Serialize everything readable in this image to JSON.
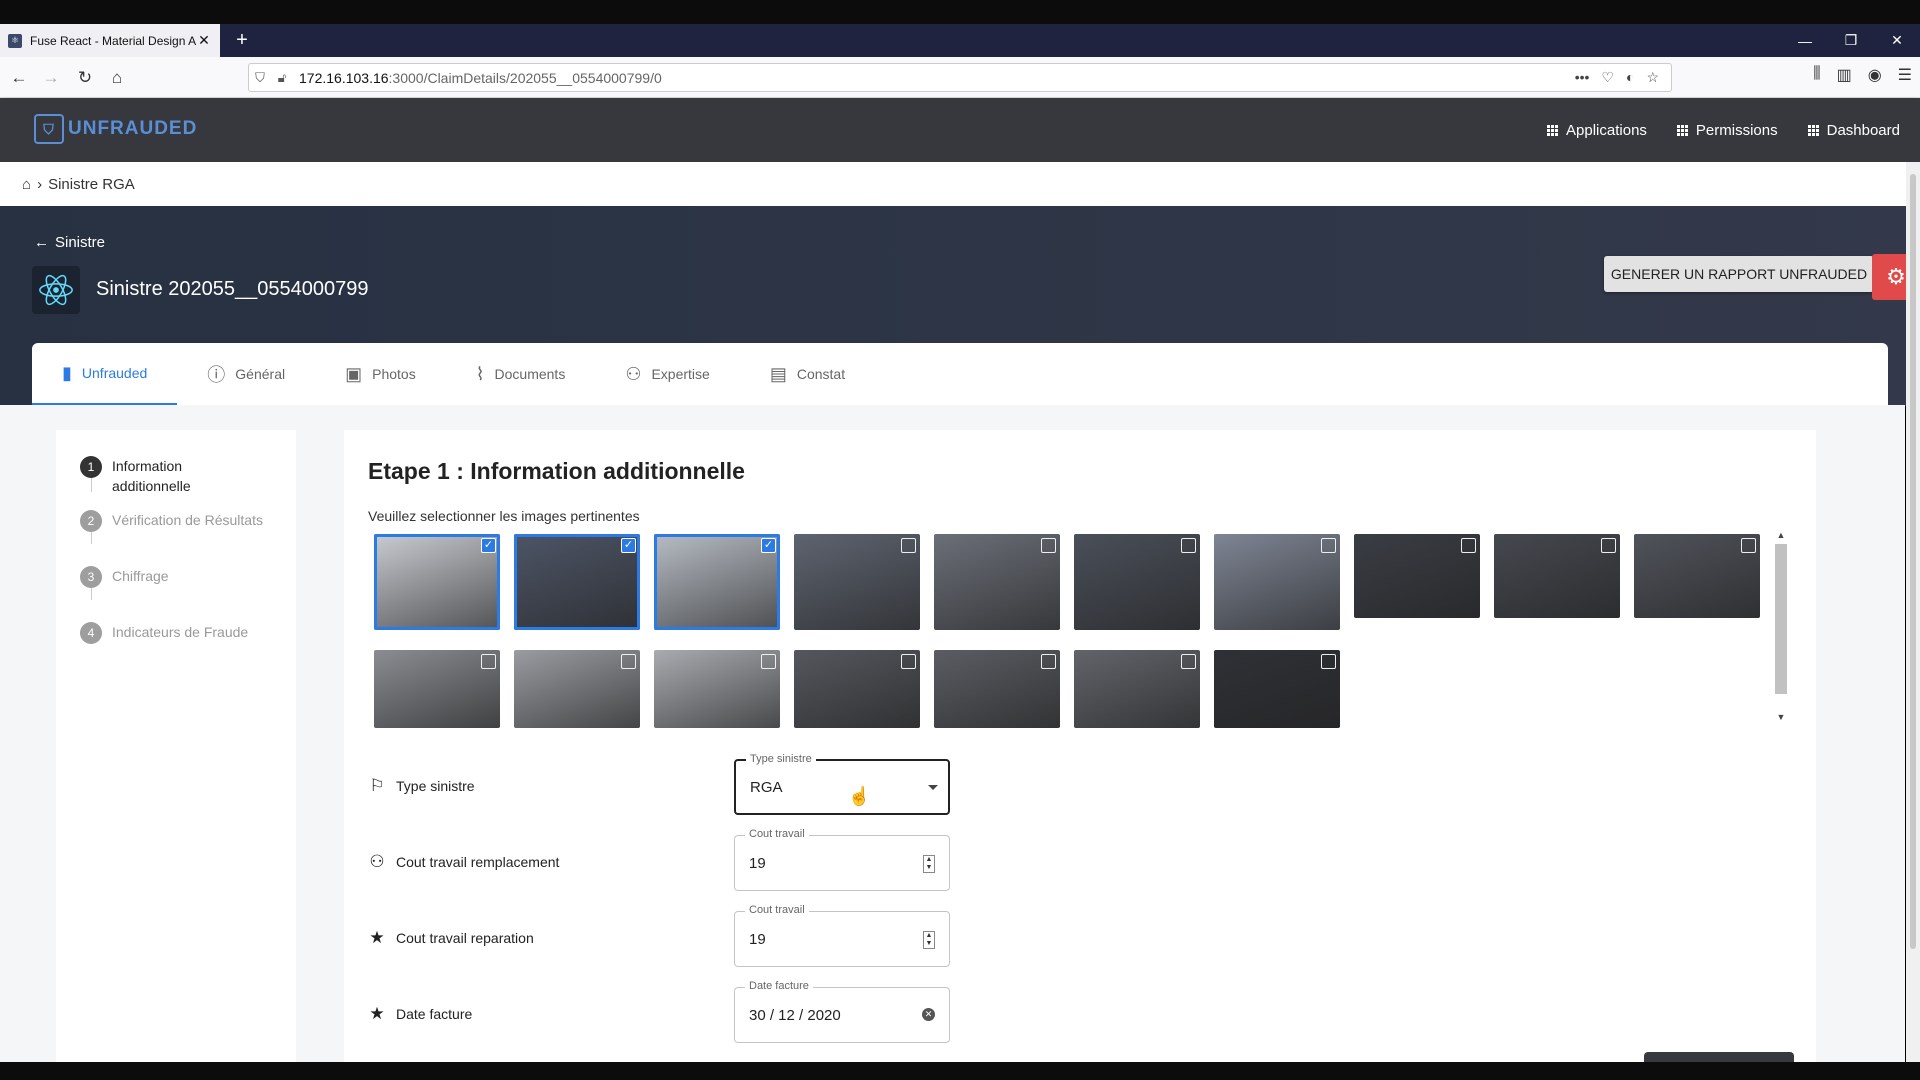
{
  "browser": {
    "tab_title": "Fuse React - Material Design A",
    "url_host": "172.16.103.16",
    "url_path": ":3000/ClaimDetails/202055__0554000799/0"
  },
  "app": {
    "logo_text": "UNFRAUDED",
    "menu": [
      {
        "label": "Applications"
      },
      {
        "label": "Permissions"
      },
      {
        "label": "Dashboard"
      }
    ]
  },
  "breadcrumb": {
    "current": "Sinistre RGA"
  },
  "header": {
    "back_label": "Sinistre",
    "title": "Sinistre 202055__0554000799",
    "report_button": "GENERER UN RAPPORT UNFRAUDED"
  },
  "tabs": [
    {
      "label": "Unfrauded",
      "icon": "bookmark-icon",
      "active": true
    },
    {
      "label": "Général",
      "icon": "info-icon",
      "active": false
    },
    {
      "label": "Photos",
      "icon": "image-icon",
      "active": false
    },
    {
      "label": "Documents",
      "icon": "paperclip-icon",
      "active": false
    },
    {
      "label": "Expertise",
      "icon": "user-icon",
      "active": false
    },
    {
      "label": "Constat",
      "icon": "document-icon",
      "active": false
    }
  ],
  "steps": [
    {
      "num": "1",
      "label": "Information additionnelle",
      "active": true
    },
    {
      "num": "2",
      "label": "Vérification de Résultats",
      "active": false
    },
    {
      "num": "3",
      "label": "Chiffrage",
      "active": false
    },
    {
      "num": "4",
      "label": "Indicateurs de Fraude",
      "active": false
    }
  ],
  "main": {
    "heading": "Etape 1 : Information additionnelle",
    "subtitle": "Veuillez selectionner les images pertinentes",
    "photos": [
      {
        "selected": true,
        "tone": "#c9ccd2"
      },
      {
        "selected": true,
        "tone": "#4d5566"
      },
      {
        "selected": true,
        "tone": "#b8bdc5"
      },
      {
        "selected": false,
        "tone": "#5e6470"
      },
      {
        "selected": false,
        "tone": "#6b6f78"
      },
      {
        "selected": false,
        "tone": "#4a4f59"
      },
      {
        "selected": false,
        "tone": "#7e8594"
      },
      {
        "selected": false,
        "tone": "#3a3d44"
      },
      {
        "selected": false,
        "tone": "#45484f"
      },
      {
        "selected": false,
        "tone": "#50535b"
      },
      {
        "selected": false,
        "tone": "#8b8d92"
      },
      {
        "selected": false,
        "tone": "#9a9ca1"
      },
      {
        "selected": false,
        "tone": "#a9abb0"
      },
      {
        "selected": false,
        "tone": "#55575d"
      },
      {
        "selected": false,
        "tone": "#5b5d63"
      },
      {
        "selected": false,
        "tone": "#62646a"
      },
      {
        "selected": false,
        "tone": "#2f3136"
      }
    ],
    "fields": [
      {
        "row_label": "Type sinistre",
        "icon": "flag-icon",
        "field_label": "Type sinistre",
        "value": "RGA",
        "kind": "select"
      },
      {
        "row_label": "Cout travail remplacement",
        "icon": "person-icon",
        "field_label": "Cout travail",
        "value": "19",
        "kind": "number"
      },
      {
        "row_label": "Cout travail reparation",
        "icon": "star-icon",
        "field_label": "Cout travail",
        "value": "19",
        "kind": "number"
      },
      {
        "row_label": "Date facture",
        "icon": "star-icon",
        "field_label": "Date facture",
        "value": "30 / 12 / 2020",
        "kind": "date"
      }
    ]
  }
}
